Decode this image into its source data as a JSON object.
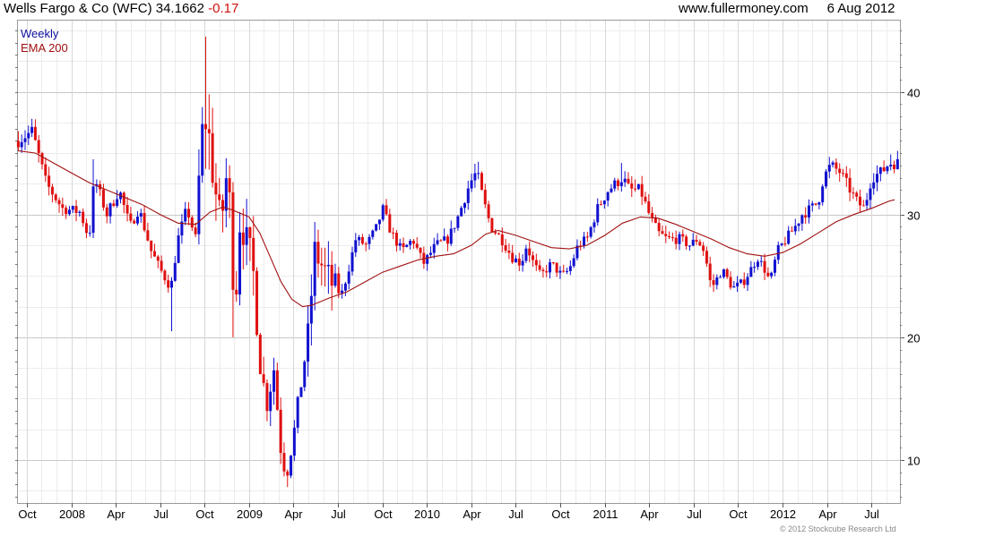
{
  "header": {
    "name": "Wells Fargo & Co (WFC)",
    "price": "34.1662",
    "change": "-0.17",
    "site": "www.fullermoney.com",
    "date": "6 Aug 2012"
  },
  "copyright": "© 2012 Stockcube Research Ltd",
  "chart_data": {
    "type": "candlestick",
    "legend": [
      "Weekly",
      "EMA 200"
    ],
    "legend_position": "top-left",
    "ylim": [
      6.5,
      45.8
    ],
    "x_range": [
      2007.7,
      2012.66
    ],
    "y_ticks": [
      10,
      20,
      30,
      40
    ],
    "x_ticks": [
      {
        "x": 2007.75,
        "label": "Oct"
      },
      {
        "x": 2008.0,
        "label": "2008"
      },
      {
        "x": 2008.25,
        "label": "Apr"
      },
      {
        "x": 2008.5,
        "label": "Jul"
      },
      {
        "x": 2008.75,
        "label": "Oct"
      },
      {
        "x": 2009.0,
        "label": "2009"
      },
      {
        "x": 2009.25,
        "label": "Apr"
      },
      {
        "x": 2009.5,
        "label": "Jul"
      },
      {
        "x": 2009.75,
        "label": "Oct"
      },
      {
        "x": 2010.0,
        "label": "2010"
      },
      {
        "x": 2010.25,
        "label": "Apr"
      },
      {
        "x": 2010.5,
        "label": "Jul"
      },
      {
        "x": 2010.75,
        "label": "Oct"
      },
      {
        "x": 2011.0,
        "label": "2011"
      },
      {
        "x": 2011.25,
        "label": "Apr"
      },
      {
        "x": 2011.5,
        "label": "Jul"
      },
      {
        "x": 2011.75,
        "label": "Oct"
      },
      {
        "x": 2012.0,
        "label": "2012"
      },
      {
        "x": 2012.25,
        "label": "Apr"
      },
      {
        "x": 2012.5,
        "label": "Jul"
      }
    ],
    "grid": true,
    "up_color": "#1010d0",
    "down_color": "#e01010",
    "ema_color": "#a01010",
    "close_path": [
      [
        2007.7,
        36.0
      ],
      [
        2007.78,
        36.8
      ],
      [
        2007.86,
        32.5
      ],
      [
        2007.95,
        30.5
      ],
      [
        2008.05,
        30.2
      ],
      [
        2008.1,
        28.0
      ],
      [
        2008.13,
        33.0
      ],
      [
        2008.2,
        30.0
      ],
      [
        2008.27,
        32.0
      ],
      [
        2008.33,
        29.0
      ],
      [
        2008.38,
        30.5
      ],
      [
        2008.45,
        27.0
      ],
      [
        2008.52,
        25.0
      ],
      [
        2008.56,
        24.0
      ],
      [
        2008.6,
        28.0
      ],
      [
        2008.65,
        30.5
      ],
      [
        2008.7,
        28.0
      ],
      [
        2008.73,
        36.0
      ],
      [
        2008.76,
        38.0
      ],
      [
        2008.8,
        33.0
      ],
      [
        2008.84,
        29.0
      ],
      [
        2008.88,
        34.0
      ],
      [
        2008.92,
        22.0
      ],
      [
        2008.95,
        30.0
      ],
      [
        2008.98,
        28.0
      ],
      [
        2009.02,
        26.0
      ],
      [
        2009.06,
        18.0
      ],
      [
        2009.1,
        14.5
      ],
      [
        2009.14,
        17.5
      ],
      [
        2009.18,
        10.5
      ],
      [
        2009.21,
        8.6
      ],
      [
        2009.25,
        12.0
      ],
      [
        2009.3,
        17.0
      ],
      [
        2009.33,
        20.0
      ],
      [
        2009.37,
        27.0
      ],
      [
        2009.42,
        25.5
      ],
      [
        2009.48,
        24.0
      ],
      [
        2009.52,
        23.5
      ],
      [
        2009.55,
        25.0
      ],
      [
        2009.6,
        28.0
      ],
      [
        2009.66,
        27.5
      ],
      [
        2009.72,
        29.0
      ],
      [
        2009.75,
        30.5
      ],
      [
        2009.8,
        28.5
      ],
      [
        2009.86,
        27.0
      ],
      [
        2009.92,
        28.0
      ],
      [
        2009.98,
        26.0
      ],
      [
        2010.05,
        27.5
      ],
      [
        2010.12,
        28.0
      ],
      [
        2010.18,
        30.0
      ],
      [
        2010.24,
        32.5
      ],
      [
        2010.28,
        33.5
      ],
      [
        2010.32,
        31.0
      ],
      [
        2010.36,
        29.0
      ],
      [
        2010.42,
        28.0
      ],
      [
        2010.48,
        26.5
      ],
      [
        2010.53,
        26.0
      ],
      [
        2010.56,
        27.5
      ],
      [
        2010.6,
        26.0
      ],
      [
        2010.64,
        25.0
      ],
      [
        2010.7,
        26.0
      ],
      [
        2010.76,
        25.0
      ],
      [
        2010.8,
        25.5
      ],
      [
        2010.85,
        27.5
      ],
      [
        2010.9,
        28.0
      ],
      [
        2010.96,
        30.5
      ],
      [
        2011.02,
        32.0
      ],
      [
        2011.06,
        32.5
      ],
      [
        2011.1,
        33.0
      ],
      [
        2011.14,
        32.0
      ],
      [
        2011.2,
        32.0
      ],
      [
        2011.25,
        30.0
      ],
      [
        2011.3,
        28.5
      ],
      [
        2011.35,
        28.0
      ],
      [
        2011.42,
        28.0
      ],
      [
        2011.48,
        27.5
      ],
      [
        2011.52,
        28.0
      ],
      [
        2011.56,
        27.0
      ],
      [
        2011.6,
        24.0
      ],
      [
        2011.66,
        25.5
      ],
      [
        2011.72,
        24.0
      ],
      [
        2011.78,
        24.5
      ],
      [
        2011.82,
        25.5
      ],
      [
        2011.86,
        26.5
      ],
      [
        2011.9,
        25.5
      ],
      [
        2011.93,
        24.5
      ],
      [
        2011.97,
        27.0
      ],
      [
        2012.02,
        28.0
      ],
      [
        2012.07,
        29.0
      ],
      [
        2012.11,
        30.0
      ],
      [
        2012.16,
        30.5
      ],
      [
        2012.2,
        31.0
      ],
      [
        2012.23,
        33.0
      ],
      [
        2012.27,
        34.0
      ],
      [
        2012.32,
        33.5
      ],
      [
        2012.36,
        32.5
      ],
      [
        2012.42,
        31.0
      ],
      [
        2012.46,
        30.5
      ],
      [
        2012.5,
        33.0
      ],
      [
        2012.56,
        33.5
      ],
      [
        2012.6,
        34.2
      ]
    ],
    "ema_path": [
      [
        2007.7,
        35.2
      ],
      [
        2007.8,
        35.0
      ],
      [
        2007.9,
        34.2
      ],
      [
        2008.0,
        33.4
      ],
      [
        2008.1,
        32.6
      ],
      [
        2008.2,
        32.0
      ],
      [
        2008.3,
        31.4
      ],
      [
        2008.4,
        30.8
      ],
      [
        2008.5,
        30.0
      ],
      [
        2008.6,
        29.3
      ],
      [
        2008.7,
        29.2
      ],
      [
        2008.78,
        30.2
      ],
      [
        2008.85,
        30.6
      ],
      [
        2008.9,
        30.4
      ],
      [
        2009.0,
        29.8
      ],
      [
        2009.06,
        28.5
      ],
      [
        2009.12,
        26.5
      ],
      [
        2009.18,
        24.5
      ],
      [
        2009.24,
        23.1
      ],
      [
        2009.3,
        22.5
      ],
      [
        2009.35,
        22.6
      ],
      [
        2009.45,
        23.2
      ],
      [
        2009.55,
        23.7
      ],
      [
        2009.65,
        24.5
      ],
      [
        2009.75,
        25.3
      ],
      [
        2009.85,
        25.8
      ],
      [
        2009.95,
        26.3
      ],
      [
        2010.05,
        26.6
      ],
      [
        2010.15,
        26.8
      ],
      [
        2010.25,
        27.5
      ],
      [
        2010.33,
        28.4
      ],
      [
        2010.4,
        28.7
      ],
      [
        2010.5,
        28.3
      ],
      [
        2010.6,
        27.8
      ],
      [
        2010.7,
        27.3
      ],
      [
        2010.8,
        27.2
      ],
      [
        2010.9,
        27.5
      ],
      [
        2011.0,
        28.3
      ],
      [
        2011.1,
        29.3
      ],
      [
        2011.2,
        29.8
      ],
      [
        2011.3,
        29.7
      ],
      [
        2011.4,
        29.2
      ],
      [
        2011.5,
        28.6
      ],
      [
        2011.6,
        28.0
      ],
      [
        2011.7,
        27.3
      ],
      [
        2011.8,
        26.8
      ],
      [
        2011.9,
        26.6
      ],
      [
        2012.0,
        26.9
      ],
      [
        2012.1,
        27.6
      ],
      [
        2012.2,
        28.5
      ],
      [
        2012.3,
        29.4
      ],
      [
        2012.4,
        30.0
      ],
      [
        2012.5,
        30.5
      ],
      [
        2012.6,
        31.1
      ],
      [
        2012.63,
        31.2
      ]
    ],
    "spikes": [
      {
        "x": 2007.77,
        "high": 37.8
      },
      {
        "x": 2008.13,
        "high": 34.5
      },
      {
        "x": 2008.57,
        "low": 20.5
      },
      {
        "x": 2008.76,
        "high": 44.5
      },
      {
        "x": 2008.91,
        "low": 20.0
      },
      {
        "x": 2009.22,
        "low": 7.8
      },
      {
        "x": 2010.28,
        "high": 34.3
      },
      {
        "x": 2011.1,
        "high": 34.2
      },
      {
        "x": 2012.26,
        "high": 34.7
      },
      {
        "x": 2012.61,
        "high": 34.9
      }
    ]
  }
}
